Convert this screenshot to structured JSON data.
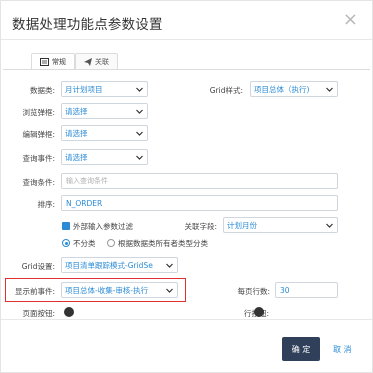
{
  "dialog": {
    "title": "数据处理功能点参数设置",
    "close_glyph": "×"
  },
  "tabs": [
    {
      "label": "常规",
      "icon": "list-icon"
    },
    {
      "label": "关联",
      "icon": "send-icon"
    }
  ],
  "form": {
    "data_type": {
      "label": "数据类:",
      "value": "月计划项目"
    },
    "grid_style": {
      "label": "Grid样式:",
      "value": "项目总体（执行)"
    },
    "browse_popup": {
      "label": "浏览弹框:",
      "value": "请选择"
    },
    "edit_popup": {
      "label": "编辑弹框:",
      "value": "请选择"
    },
    "query_event": {
      "label": "查询事件:",
      "value": "请选择"
    },
    "query_condition": {
      "label": "查询条件:",
      "placeholder": "输入查询条件"
    },
    "sort": {
      "label": "排序:",
      "value": "N_ORDER"
    },
    "external_filter": {
      "label": "外部输入参数过滤",
      "checked": true
    },
    "link_field": {
      "label": "关联字段:",
      "value": "计划月份"
    },
    "classify": {
      "option1": "不分类",
      "option2": "根据数据类所有者类型分类",
      "selected": "不分类"
    },
    "grid_setting": {
      "label": "Grid设置:",
      "value": "项目清单跟踪模式-GridSe"
    },
    "pre_display_event": {
      "label": "显示前事件:",
      "value": "项目总体-收集-审核-执行"
    },
    "rows_per_page": {
      "label": "每页行数:",
      "value": "30"
    },
    "page_button": {
      "label": "页面按钮:"
    },
    "row_button": {
      "label": "行按钮:"
    }
  },
  "footer": {
    "ok_label": "确 定",
    "cancel_label": "取 消"
  },
  "colors": {
    "accent": "#2a8bd7",
    "primary_button": "#30405a",
    "highlight_border": "#e03131"
  }
}
